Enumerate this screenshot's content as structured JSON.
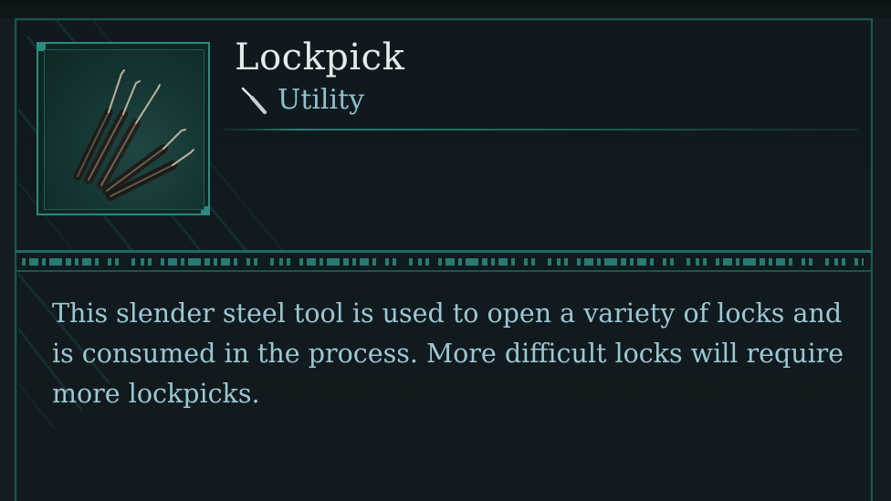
{
  "item": {
    "name": "Lockpick",
    "category": "Utility",
    "category_icon": "pick-tool-icon",
    "image_icon": "lockpick-bundle-icon",
    "description": "This slender steel tool is used to open a variety of locks and is consumed in the process. More difficult locks will require more lockpicks."
  },
  "theme": {
    "accent": "#2b8a7e",
    "title_color": "#e6ebec",
    "text_color": "#9ac8d4",
    "background": "#131c20"
  }
}
